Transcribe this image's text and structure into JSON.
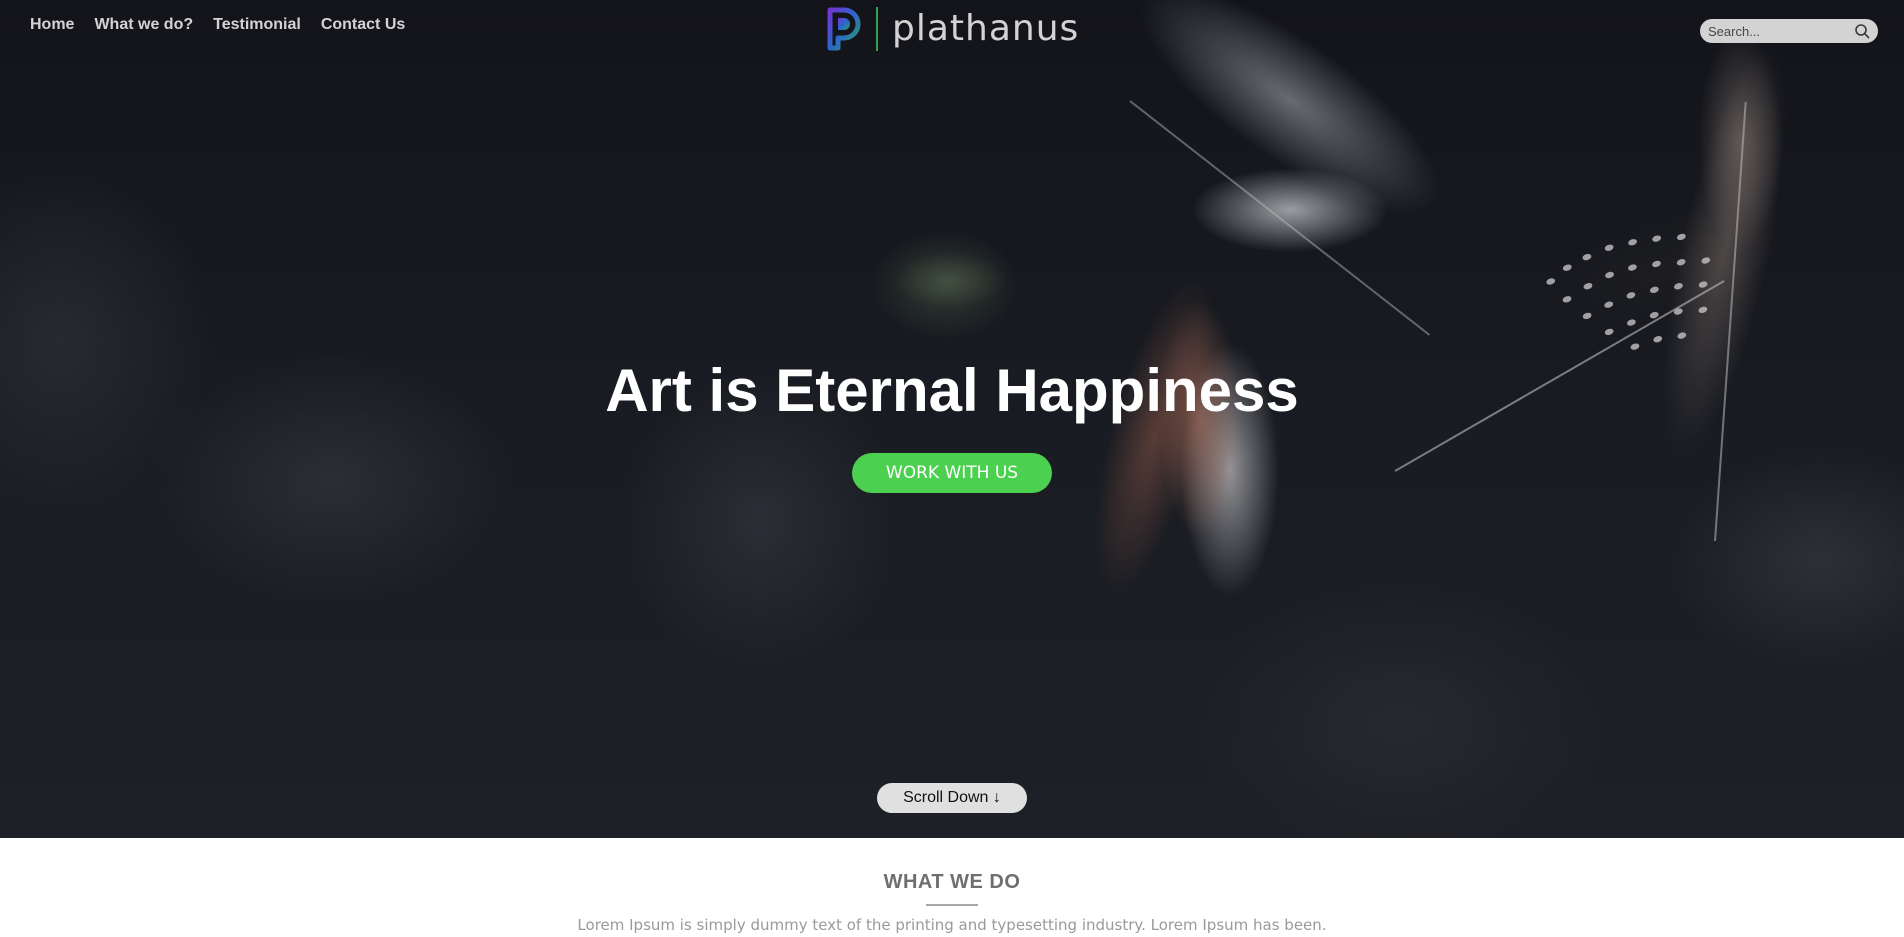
{
  "nav": {
    "items": [
      {
        "label": "Home"
      },
      {
        "label": "What we do?"
      },
      {
        "label": "Testimonial"
      },
      {
        "label": "Contact Us"
      }
    ]
  },
  "brand": {
    "name": "plathanus",
    "icon": "logo-mark-icon",
    "colors": {
      "green": "#3fbf6a",
      "purple": "#8a3ffc",
      "blue": "#2f7df6"
    }
  },
  "search": {
    "placeholder": "Search...",
    "value": "",
    "icon": "search-icon"
  },
  "hero": {
    "headline": "Art is Eternal Happiness",
    "cta_label": "WORK WITH US",
    "cta_color": "#4cd04f",
    "scroll_label": "Scroll Down ↓"
  },
  "section": {
    "title": "WHAT WE DO",
    "text": "Lorem Ipsum is simply dummy text of the printing and typesetting industry. Lorem Ipsum has been."
  }
}
